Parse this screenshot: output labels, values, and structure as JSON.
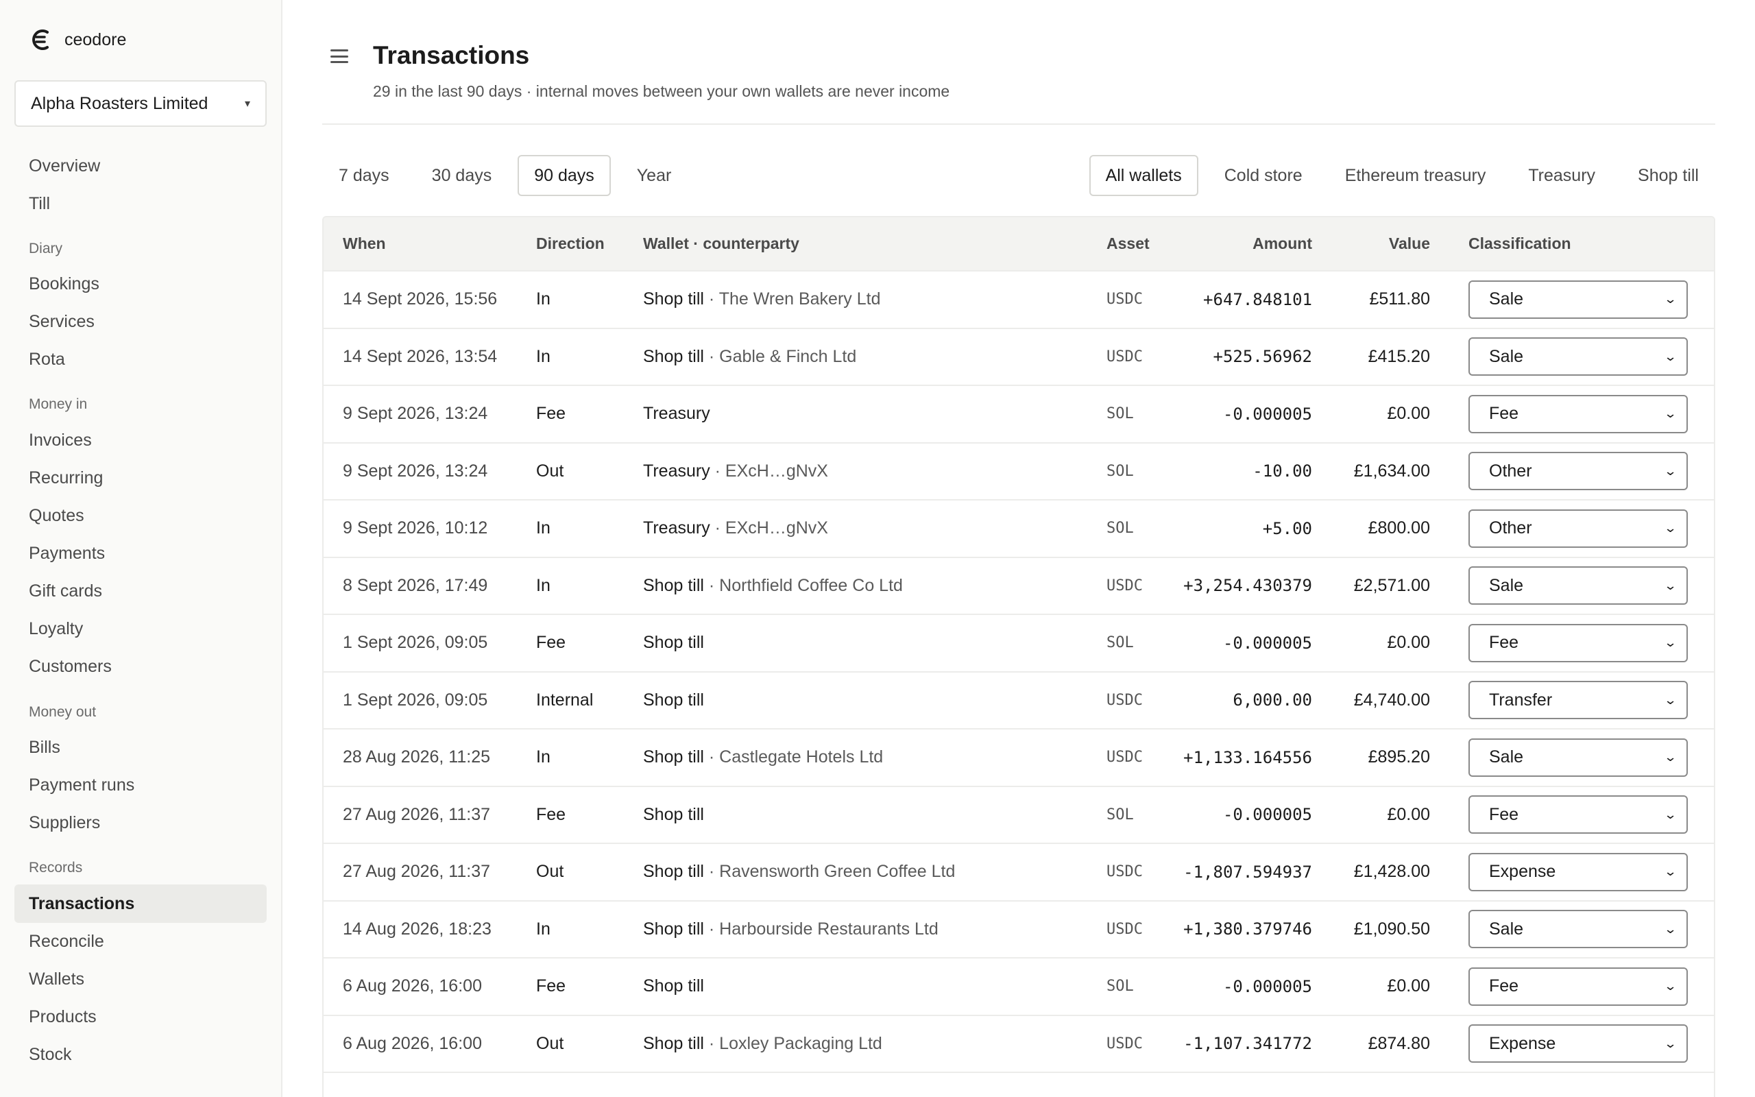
{
  "brand": {
    "name": "ceodore",
    "icon": "ceodore-logo-icon"
  },
  "org": {
    "name": "Alpha Roasters Limited",
    "caret": "▾"
  },
  "nav": {
    "overview": "Overview",
    "till": "Till",
    "diary_label": "Diary",
    "bookings": "Bookings",
    "services": "Services",
    "rota": "Rota",
    "money_in_label": "Money in",
    "invoices": "Invoices",
    "recurring": "Recurring",
    "quotes": "Quotes",
    "payments": "Payments",
    "gift_cards": "Gift cards",
    "loyalty": "Loyalty",
    "customers": "Customers",
    "money_out_label": "Money out",
    "bills": "Bills",
    "payment_runs": "Payment runs",
    "suppliers": "Suppliers",
    "records_label": "Records",
    "transactions": "Transactions",
    "reconcile": "Reconcile",
    "wallets": "Wallets",
    "products": "Products",
    "stock": "Stock"
  },
  "header": {
    "title": "Transactions",
    "subtitle": "29 in the last 90 days · internal moves between your own wallets are never income"
  },
  "period_tabs": [
    "7 days",
    "30 days",
    "90 days",
    "Year"
  ],
  "period_active": "90 days",
  "wallet_tabs": [
    "All wallets",
    "Cold store",
    "Ethereum treasury",
    "Treasury",
    "Shop till"
  ],
  "wallet_active": "All wallets",
  "table": {
    "columns": {
      "when": "When",
      "direction": "Direction",
      "wallet": "Wallet · counterparty",
      "asset": "Asset",
      "amount": "Amount",
      "value": "Value",
      "classification": "Classification"
    },
    "rows": [
      {
        "when": "14 Sept 2026, 15:56",
        "direction": "In",
        "wallet": "Shop till",
        "counterparty": " · The Wren Bakery Ltd",
        "asset": "USDC",
        "amount": "+647.848101",
        "value": "£511.80",
        "classification": "Sale"
      },
      {
        "when": "14 Sept 2026, 13:54",
        "direction": "In",
        "wallet": "Shop till",
        "counterparty": " · Gable & Finch Ltd",
        "asset": "USDC",
        "amount": "+525.56962",
        "value": "£415.20",
        "classification": "Sale"
      },
      {
        "when": "9 Sept 2026, 13:24",
        "direction": "Fee",
        "wallet": "Treasury",
        "counterparty": "",
        "asset": "SOL",
        "amount": "-0.000005",
        "value": "£0.00",
        "classification": "Fee"
      },
      {
        "when": "9 Sept 2026, 13:24",
        "direction": "Out",
        "wallet": "Treasury",
        "counterparty": " · EXcH…gNvX",
        "asset": "SOL",
        "amount": "-10.00",
        "value": "£1,634.00",
        "classification": "Other"
      },
      {
        "when": "9 Sept 2026, 10:12",
        "direction": "In",
        "wallet": "Treasury",
        "counterparty": " · EXcH…gNvX",
        "asset": "SOL",
        "amount": "+5.00",
        "value": "£800.00",
        "classification": "Other"
      },
      {
        "when": "8 Sept 2026, 17:49",
        "direction": "In",
        "wallet": "Shop till",
        "counterparty": " · Northfield Coffee Co Ltd",
        "asset": "USDC",
        "amount": "+3,254.430379",
        "value": "£2,571.00",
        "classification": "Sale"
      },
      {
        "when": "1 Sept 2026, 09:05",
        "direction": "Fee",
        "wallet": "Shop till",
        "counterparty": "",
        "asset": "SOL",
        "amount": "-0.000005",
        "value": "£0.00",
        "classification": "Fee"
      },
      {
        "when": "1 Sept 2026, 09:05",
        "direction": "Internal",
        "wallet": "Shop till",
        "counterparty": "",
        "asset": "USDC",
        "amount": "6,000.00",
        "value": "£4,740.00",
        "classification": "Transfer"
      },
      {
        "when": "28 Aug 2026, 11:25",
        "direction": "In",
        "wallet": "Shop till",
        "counterparty": " · Castlegate Hotels Ltd",
        "asset": "USDC",
        "amount": "+1,133.164556",
        "value": "£895.20",
        "classification": "Sale"
      },
      {
        "when": "27 Aug 2026, 11:37",
        "direction": "Fee",
        "wallet": "Shop till",
        "counterparty": "",
        "asset": "SOL",
        "amount": "-0.000005",
        "value": "£0.00",
        "classification": "Fee"
      },
      {
        "when": "27 Aug 2026, 11:37",
        "direction": "Out",
        "wallet": "Shop till",
        "counterparty": " · Ravensworth Green Coffee Ltd",
        "asset": "USDC",
        "amount": "-1,807.594937",
        "value": "£1,428.00",
        "classification": "Expense"
      },
      {
        "when": "14 Aug 2026, 18:23",
        "direction": "In",
        "wallet": "Shop till",
        "counterparty": " · Harbourside Restaurants Ltd",
        "asset": "USDC",
        "amount": "+1,380.379746",
        "value": "£1,090.50",
        "classification": "Sale"
      },
      {
        "when": "6 Aug 2026, 16:00",
        "direction": "Fee",
        "wallet": "Shop till",
        "counterparty": "",
        "asset": "SOL",
        "amount": "-0.000005",
        "value": "£0.00",
        "classification": "Fee"
      },
      {
        "when": "6 Aug 2026, 16:00",
        "direction": "Out",
        "wallet": "Shop till",
        "counterparty": " · Loxley Packaging Ltd",
        "asset": "USDC",
        "amount": "-1,107.341772",
        "value": "£874.80",
        "classification": "Expense"
      }
    ]
  },
  "colors": {
    "active_nav_bg": "#ebebe8",
    "border": "#ececea",
    "header_bg": "#f3f3f1"
  }
}
